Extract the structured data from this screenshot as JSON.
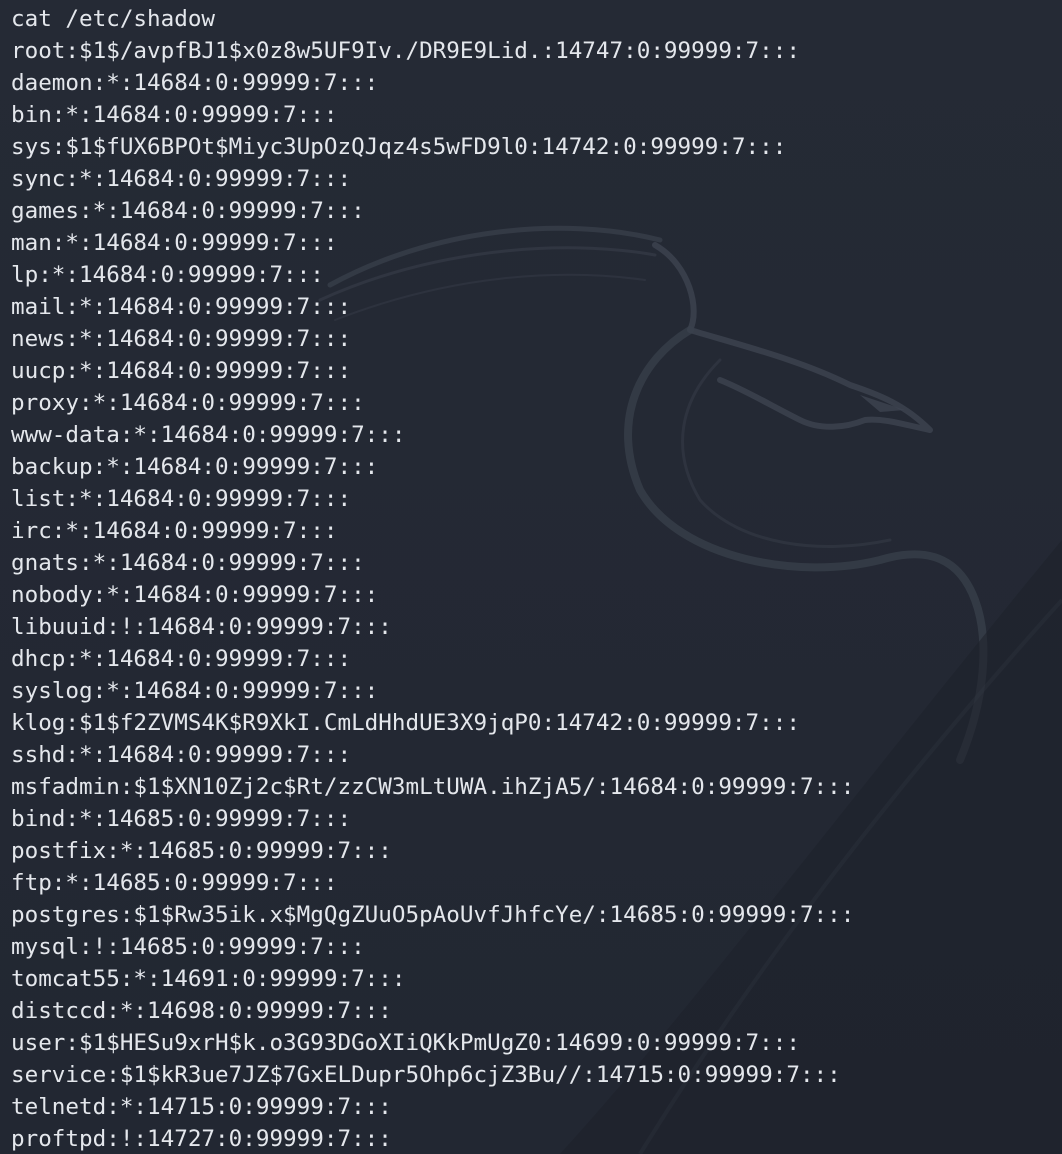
{
  "terminal": {
    "command": "cat /etc/shadow",
    "lines": [
      "root:$1$/avpfBJ1$x0z8w5UF9Iv./DR9E9Lid.:14747:0:99999:7:::",
      "daemon:*:14684:0:99999:7:::",
      "bin:*:14684:0:99999:7:::",
      "sys:$1$fUX6BPOt$Miyc3UpOzQJqz4s5wFD9l0:14742:0:99999:7:::",
      "sync:*:14684:0:99999:7:::",
      "games:*:14684:0:99999:7:::",
      "man:*:14684:0:99999:7:::",
      "lp:*:14684:0:99999:7:::",
      "mail:*:14684:0:99999:7:::",
      "news:*:14684:0:99999:7:::",
      "uucp:*:14684:0:99999:7:::",
      "proxy:*:14684:0:99999:7:::",
      "www-data:*:14684:0:99999:7:::",
      "backup:*:14684:0:99999:7:::",
      "list:*:14684:0:99999:7:::",
      "irc:*:14684:0:99999:7:::",
      "gnats:*:14684:0:99999:7:::",
      "nobody:*:14684:0:99999:7:::",
      "libuuid:!:14684:0:99999:7:::",
      "dhcp:*:14684:0:99999:7:::",
      "syslog:*:14684:0:99999:7:::",
      "klog:$1$f2ZVMS4K$R9XkI.CmLdHhdUE3X9jqP0:14742:0:99999:7:::",
      "sshd:*:14684:0:99999:7:::",
      "msfadmin:$1$XN10Zj2c$Rt/zzCW3mLtUWA.ihZjA5/:14684:0:99999:7:::",
      "bind:*:14685:0:99999:7:::",
      "postfix:*:14685:0:99999:7:::",
      "ftp:*:14685:0:99999:7:::",
      "postgres:$1$Rw35ik.x$MgQgZUuO5pAoUvfJhfcYe/:14685:0:99999:7:::",
      "mysql:!:14685:0:99999:7:::",
      "tomcat55:*:14691:0:99999:7:::",
      "distccd:*:14698:0:99999:7:::",
      "user:$1$HESu9xrH$k.o3G93DGoXIiQKkPmUgZ0:14699:0:99999:7:::",
      "service:$1$kR3ue7JZ$7GxELDupr5Ohp6cjZ3Bu//:14715:0:99999:7:::",
      "telnetd:*:14715:0:99999:7:::",
      "proftpd:!:14727:0:99999:7:::"
    ]
  },
  "theme": {
    "background": "#232833",
    "text": "#e4e7ec",
    "wallpaper_logo": "dragon-logo"
  }
}
